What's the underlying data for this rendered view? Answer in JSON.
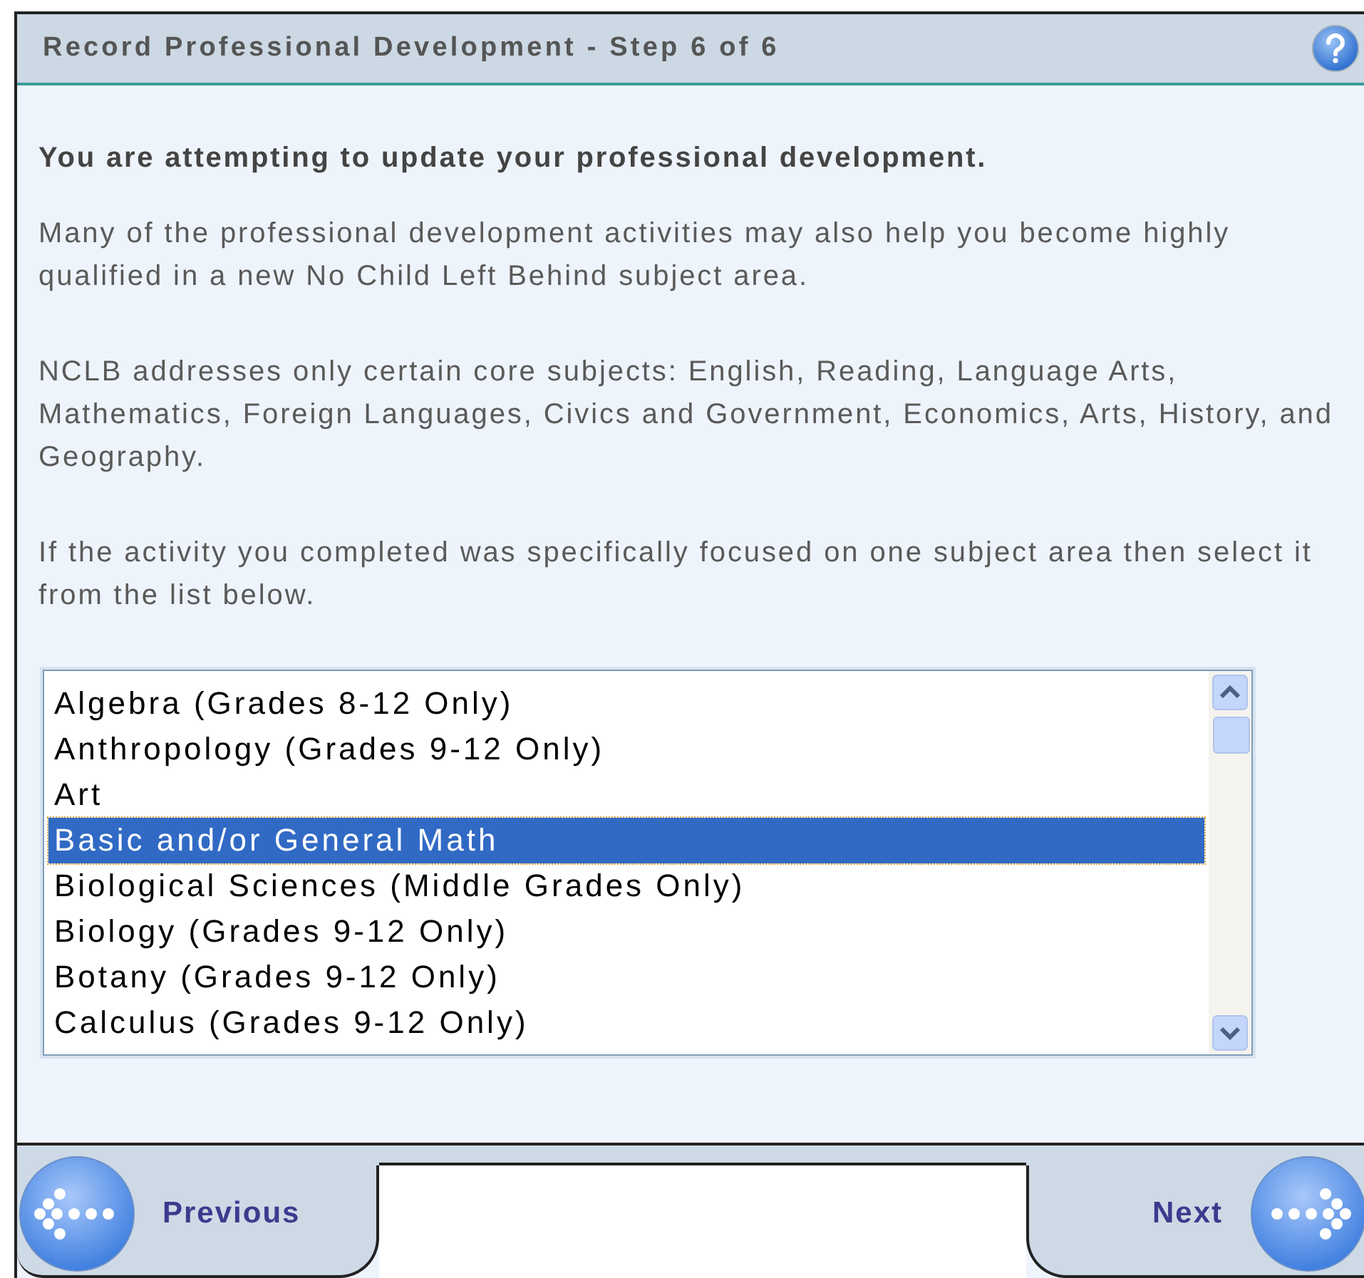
{
  "window": {
    "title": "Record Professional Development - Step 6 of 6"
  },
  "heading": "You are attempting to update your professional development.",
  "paragraphs": [
    "Many of the professional development activities may also help you become highly qualified in a new No Child Left Behind subject area.",
    "NCLB addresses only certain core subjects: English, Reading, Language Arts, Mathematics, Foreign Languages, Civics and Government, Economics, Arts, History, and Geography.",
    "If the activity you completed was specifically focused on one subject area then select it from the list below."
  ],
  "subject_list": [
    {
      "label": "Algebra (Grades 8-12 Only)",
      "selected": false
    },
    {
      "label": "Anthropology (Grades 9-12 Only)",
      "selected": false
    },
    {
      "label": "Art",
      "selected": false
    },
    {
      "label": "Basic and/or General Math",
      "selected": true
    },
    {
      "label": "Biological Sciences (Middle Grades Only)",
      "selected": false
    },
    {
      "label": "Biology (Grades 9-12 Only)",
      "selected": false
    },
    {
      "label": "Botany (Grades 9-12 Only)",
      "selected": false
    },
    {
      "label": "Calculus (Grades 9-12 Only)",
      "selected": false
    }
  ],
  "footer": {
    "previous": "Previous",
    "next": "Next"
  }
}
